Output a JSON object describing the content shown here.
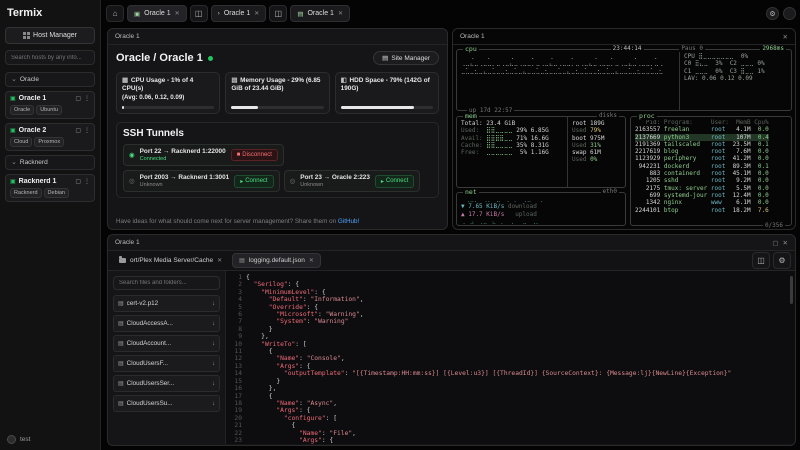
{
  "app": {
    "brand": "Termix"
  },
  "sidebar": {
    "host_manager": "Host Manager",
    "search_placeholder": "Search hosts by any info...",
    "groups": [
      {
        "label": "Oracle",
        "hosts": [
          {
            "name": "Oracle 1",
            "tags": [
              "Oracle",
              "Ubuntu"
            ]
          },
          {
            "name": "Oracle 2",
            "tags": [
              "Cloud",
              "Proxmox"
            ]
          }
        ]
      },
      {
        "label": "Racknerd",
        "hosts": [
          {
            "name": "Racknerd 1",
            "tags": [
              "Racknerd",
              "Debian"
            ]
          }
        ]
      }
    ],
    "footer_label": "test"
  },
  "tabbar": {
    "tabs": [
      {
        "label": "Oracle 1",
        "icon": "server"
      },
      {
        "label": "Oracle 1",
        "icon": "shell"
      },
      {
        "label": "Oracle 1",
        "icon": "files"
      }
    ]
  },
  "overview": {
    "panel_title": "Oracle 1",
    "breadcrumb": "Oracle / Oracle 1",
    "site_manager": "Site Manager",
    "stats": [
      {
        "icon": "cpu",
        "title": "CPU Usage - 1% of 4 CPU(s)",
        "subtitle": "(Avg: 0.06, 0.12, 0.09)",
        "percent": 1
      },
      {
        "icon": "memory",
        "title": "Memory Usage - 29% (6.85 GiB of 23.44 GiB)",
        "subtitle": "",
        "percent": 29
      },
      {
        "icon": "disk",
        "title": "HDD Space - 79% (142G of 190G)",
        "subtitle": "",
        "percent": 79
      }
    ],
    "tunnels_title": "SSH Tunnels",
    "tunnels": [
      {
        "route": "Port 22 → Racknerd 1:22000",
        "status": "Connected",
        "action": "Disconnect",
        "connected": true
      },
      {
        "route": "Port 2003 → Racknerd 1:3001",
        "status": "Unknown",
        "action": "Connect",
        "connected": false
      },
      {
        "route": "Port 23 → Oracle 2:223",
        "status": "Unknown",
        "action": "Connect",
        "connected": false
      }
    ],
    "footer_text": "Have ideas for what should come next for server management? Share them on ",
    "footer_link": "GitHub!"
  },
  "terminal": {
    "panel_title": "Oracle 1",
    "time": "23:44:14",
    "latency": "2968ms",
    "pause_label": "Paus 0",
    "uptime": "up 17d 22:57",
    "cpu": {
      "title": "cpu",
      "graph": [
        "⠀⠀⢀⠀⠀⠀⡀⠀⠀⠀⠀⢀⠀⠀⠀⠀⡀⠀⠀⠀⢀⠀⠀⠀⠀⡀⠀⠀⠀⠀⢀⠀⠀⠀⡀⠀⠀⠀⠀⢀⠀⠀⠀⠀⡀⠀",
        "⢀⣀⣄⣀⢀⣀⣀⡀⣀⢀⣀⣄⣀⢀⣀⣀⡀⣀⢀⣀⣄⣀⢀⣀⣀⡀⣀⢀⣀⣄⣀⢀⣀⣀⡀⣀⢀⣀⣄⣀⢀⣀⣀⡀⣀⢀",
        "⣀⣁⣀⣂⣀⣄⣀⣁⣀⣀⣂⣀⣁⣀⣄⣀⣀⣁⣀⣂⣀⣀⣁⣀⣄⣀⣂⣀⣁⣀⣀⣂⣀⣁⣀⣄⣀⣀⣁⣀⣂⣀⣀⣁⣀⣂"
      ],
      "meters": [
        "CPU ⣿⣀⣀⣀⣀⣀⣀⣀  0%",
        "C0 ⣿⣄⣀  3%  C2 ⣀⣀⣀ 0%",
        "C1 ⣀⣀⣀  0%  C3 ⣿⣀⣀ 1%",
        "LAV: 0.06 0.12 0.09"
      ]
    },
    "mem": {
      "title": "mem",
      "total_label": "Total:",
      "total": "23.4 GiB",
      "rows": [
        {
          "label": "Used:",
          "pct": 29,
          "val": "6.85G"
        },
        {
          "label": "Avail:",
          "pct": 71,
          "val": "16.6G"
        },
        {
          "label": "Cache:",
          "pct": 35,
          "val": "8.31G"
        },
        {
          "label": "Free:",
          "pct": 5,
          "val": "1.16G"
        }
      ],
      "disks_title": "disks",
      "disks": [
        {
          "name": "root",
          "size": "189G",
          "used": "79%"
        },
        {
          "name": "boot",
          "size": "975M",
          "used": "31%"
        },
        {
          "name": "swap",
          "size": "61M",
          "used": "0%"
        }
      ]
    },
    "net": {
      "title": "net",
      "iface": "eth0",
      "down": "▼ 7.65 KiB/s",
      "down_label": "download",
      "up": "▲ 17.7 KiB/s",
      "up_label": "upload",
      "down_graph": "⠀⢀⣀⡀⠀⢀⡀⠀⣀⠀⢀⠀⡀⠀⢀⣀⠀⠀⡀⠀",
      "up_graph": "⢀⠀⣠⠀⢀⣀⠀⣄⠀⡀⠀⢀⠀⠀⣀⠀⢀⡀⠀⠀"
    },
    "proc": {
      "title": "proc",
      "columns": [
        "Pid:",
        "Program:",
        "User:",
        "MemB",
        "Cpu%"
      ],
      "selected": 1,
      "rows": [
        [
          "2163557",
          "freelan",
          "root",
          "4.1M",
          "0.0"
        ],
        [
          "2137669",
          "python3",
          "root",
          "107M",
          "0.4"
        ],
        [
          "2191369",
          "tailscaled",
          "root",
          "23.5M",
          "0.1"
        ],
        [
          "2217619",
          "blog",
          "root",
          "7.6M",
          "0.0"
        ],
        [
          "1123929",
          "periphery",
          "root",
          "41.2M",
          "0.0"
        ],
        [
          "942231",
          "dockerd",
          "root",
          "89.3M",
          "0.1"
        ],
        [
          "883",
          "containerd",
          "root",
          "45.1M",
          "0.0"
        ],
        [
          "1205",
          "sshd",
          "root",
          "9.2M",
          "0.0"
        ],
        [
          "2175",
          "tmux: server",
          "root",
          "5.5M",
          "0.0"
        ],
        [
          "699",
          "systemd-journ",
          "root",
          "12.4M",
          "0.0"
        ],
        [
          "1342",
          "nginx",
          "www",
          "6.1M",
          "0.0"
        ],
        [
          "2244101",
          "btop",
          "root",
          "18.2M",
          "7.6"
        ]
      ],
      "footer": "0/356"
    }
  },
  "files": {
    "panel_title": "Oracle 1",
    "tabs": [
      {
        "label": "ort/Plex Media Server/Cache",
        "icon": "folder",
        "active": false
      },
      {
        "label": "logging.default.json",
        "icon": "file",
        "active": true
      }
    ],
    "search_placeholder": "Search files and folders...",
    "items": [
      "cert-v2.p12",
      "CloudAccessA...",
      "CloudAccount...",
      "CloudUsersF...",
      "CloudUsersSer...",
      "CloudUsersSu..."
    ],
    "editor_lines": [
      "{",
      "  \"Serilog\": {",
      "    \"MinimumLevel\": {",
      "      \"Default\": \"Information\",",
      "      \"Override\": {",
      "        \"Microsoft\": \"Warning\",",
      "        \"System\": \"Warning\"",
      "      }",
      "    },",
      "    \"WriteTo\": [",
      "      {",
      "        \"Name\": \"Console\",",
      "        \"Args\": {",
      "          \"outputTemplate\": \"[{Timestamp:HH:mm:ss}] [{Level:u3}] [{ThreadId}] {SourceContext}: {Message:lj}{NewLine}{Exception}\"",
      "        }",
      "      },",
      "      {",
      "        \"Name\": \"Async\",",
      "        \"Args\": {",
      "          \"configure\": [",
      "            {",
      "              \"Name\": \"File\",",
      "              \"Args\": {"
    ]
  }
}
